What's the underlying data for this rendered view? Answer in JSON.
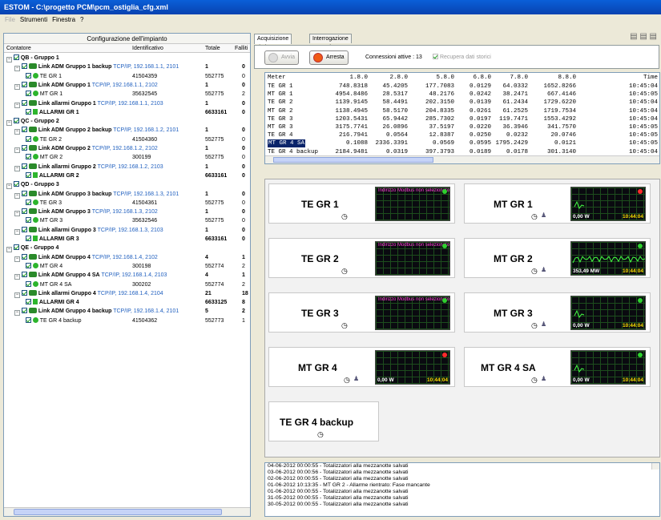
{
  "window": {
    "title": "ESTOM - C:\\progetto PCM\\pcm_ostiglia_cfg.xml"
  },
  "menu": [
    {
      "label": "File",
      "enabled": false
    },
    {
      "label": "Strumenti",
      "enabled": true
    },
    {
      "label": "Finestra",
      "enabled": true
    },
    {
      "label": "?",
      "enabled": true
    }
  ],
  "config": {
    "title": "Configurazione dell'impianto",
    "columns": [
      "Contatore",
      "Identificativo",
      "Totale",
      "Falliti"
    ],
    "rows": [
      {
        "lvl": 0,
        "kind": "group",
        "label": "QB - Gruppo 1",
        "id": "",
        "tot": "",
        "fail": ""
      },
      {
        "lvl": 1,
        "kind": "link",
        "label": "Link ADM Gruppo 1 backup",
        "addr": "TCP/IP, 192.168.1.1, 2101",
        "id": "",
        "tot": "1",
        "fail": "0"
      },
      {
        "lvl": 2,
        "kind": "meter",
        "label": "TE GR 1",
        "id": "41504359",
        "tot": "552775",
        "fail": "0"
      },
      {
        "lvl": 1,
        "kind": "link",
        "label": "Link ADM Gruppo 1",
        "addr": "TCP/IP, 192.168.1.1, 2102",
        "id": "",
        "tot": "1",
        "fail": "0"
      },
      {
        "lvl": 2,
        "kind": "meter",
        "label": "MT GR 1",
        "id": "35632545",
        "tot": "552775",
        "fail": "2"
      },
      {
        "lvl": 1,
        "kind": "link",
        "label": "Link allarmi Gruppo 1",
        "addr": "TCP/IP, 192.168.1.1, 2103",
        "id": "",
        "tot": "1",
        "fail": "0"
      },
      {
        "lvl": 2,
        "kind": "alarm",
        "label": "ALLARMI GR 1",
        "id": "",
        "tot": "6633161",
        "fail": "0"
      },
      {
        "lvl": 0,
        "kind": "group",
        "label": "QC - Gruppo 2",
        "id": "",
        "tot": "",
        "fail": ""
      },
      {
        "lvl": 1,
        "kind": "link",
        "label": "Link ADM Gruppo 2 backup",
        "addr": "TCP/IP, 192.168.1.2, 2101",
        "id": "",
        "tot": "1",
        "fail": "0"
      },
      {
        "lvl": 2,
        "kind": "meter",
        "label": "TE GR 2",
        "id": "41504360",
        "tot": "552775",
        "fail": "0"
      },
      {
        "lvl": 1,
        "kind": "link",
        "label": "Link ADM Gruppo 2",
        "addr": "TCP/IP, 192.168.1.2, 2102",
        "id": "",
        "tot": "1",
        "fail": "0"
      },
      {
        "lvl": 2,
        "kind": "meter",
        "label": "MT GR 2",
        "id": "300199",
        "tot": "552775",
        "fail": "0"
      },
      {
        "lvl": 1,
        "kind": "link",
        "label": "Link allarmi Gruppo 2",
        "addr": "TCP/IP, 192.168.1.2, 2103",
        "id": "",
        "tot": "1",
        "fail": "0"
      },
      {
        "lvl": 2,
        "kind": "alarm",
        "label": "ALLARMI GR 2",
        "id": "",
        "tot": "6633161",
        "fail": "0"
      },
      {
        "lvl": 0,
        "kind": "group",
        "label": "QD - Gruppo 3",
        "id": "",
        "tot": "",
        "fail": ""
      },
      {
        "lvl": 1,
        "kind": "link",
        "label": "Link ADM Gruppo 3 backup",
        "addr": "TCP/IP, 192.168.1.3, 2101",
        "id": "",
        "tot": "1",
        "fail": "0"
      },
      {
        "lvl": 2,
        "kind": "meter",
        "label": "TE GR 3",
        "id": "41504361",
        "tot": "552775",
        "fail": "0"
      },
      {
        "lvl": 1,
        "kind": "link",
        "label": "Link ADM Gruppo 3",
        "addr": "TCP/IP, 192.168.1.3, 2102",
        "id": "",
        "tot": "1",
        "fail": "0"
      },
      {
        "lvl": 2,
        "kind": "meter",
        "label": "MT GR 3",
        "id": "35632546",
        "tot": "552775",
        "fail": "0"
      },
      {
        "lvl": 1,
        "kind": "link",
        "label": "Link allarmi Gruppo 3",
        "addr": "TCP/IP, 192.168.1.3, 2103",
        "id": "",
        "tot": "1",
        "fail": "0"
      },
      {
        "lvl": 2,
        "kind": "alarm",
        "label": "ALLARMI GR 3",
        "id": "",
        "tot": "6633161",
        "fail": "0"
      },
      {
        "lvl": 0,
        "kind": "group",
        "label": "QE - Gruppo 4",
        "id": "",
        "tot": "",
        "fail": ""
      },
      {
        "lvl": 1,
        "kind": "link",
        "label": "Link ADM Gruppo 4",
        "addr": "TCP/IP, 192.168.1.4, 2102",
        "id": "",
        "tot": "4",
        "fail": "1"
      },
      {
        "lvl": 2,
        "kind": "meter",
        "label": "MT GR 4",
        "id": "300198",
        "tot": "552774",
        "fail": "2"
      },
      {
        "lvl": 1,
        "kind": "link",
        "label": "Link ADM Gruppo 4 SA",
        "addr": "TCP/IP, 192.168.1.4, 2103",
        "id": "",
        "tot": "4",
        "fail": "1"
      },
      {
        "lvl": 2,
        "kind": "meter",
        "label": "MT GR 4 SA",
        "id": "300202",
        "tot": "552774",
        "fail": "2"
      },
      {
        "lvl": 1,
        "kind": "link",
        "label": "Link allarmi Gruppo 4",
        "addr": "TCP/IP, 192.168.1.4, 2104",
        "id": "",
        "tot": "21",
        "fail": "18"
      },
      {
        "lvl": 2,
        "kind": "alarm",
        "label": "ALLARMI GR 4",
        "id": "",
        "tot": "6633125",
        "fail": "8"
      },
      {
        "lvl": 1,
        "kind": "link",
        "label": "Link ADM Gruppo 4 backup",
        "addr": "TCP/IP, 192.168.1.4, 2101",
        "id": "",
        "tot": "5",
        "fail": "2"
      },
      {
        "lvl": 2,
        "kind": "meter",
        "label": "TE GR 4 backup",
        "id": "41504362",
        "tot": "552773",
        "fail": "1"
      }
    ]
  },
  "tabs": [
    {
      "label": "Acquisizione dati",
      "active": true
    },
    {
      "label": "Interrogazione manuale",
      "active": false
    }
  ],
  "toolbar": {
    "start": "Avvia",
    "stop": "Arresta",
    "connections": "Connessioni attive : 13",
    "history": "Recupera dati storici"
  },
  "meters": {
    "columns": [
      "Meter",
      "1.8.0",
      "2.8.0",
      "5.8.0",
      "6.8.0",
      "7.8.0",
      "8.8.0",
      "Time"
    ],
    "rows": [
      [
        "TE GR 1",
        "748.8318",
        "45.4205",
        "177.7083",
        "0.0129",
        "64.0332",
        "1652.8266",
        "10:45:04"
      ],
      [
        "MT GR 1",
        "4954.8486",
        "28.5317",
        "48.2176",
        "0.0242",
        "38.2471",
        "667.4146",
        "10:45:05"
      ],
      [
        "TE GR 2",
        "1139.9145",
        "58.4491",
        "202.3150",
        "0.0139",
        "61.2434",
        "1729.6220",
        "10:45:04"
      ],
      [
        "MT GR 2",
        "1138.4945",
        "58.5170",
        "204.8335",
        "0.0261",
        "61.2525",
        "1719.7534",
        "10:45:04"
      ],
      [
        "TE GR 3",
        "1203.5431",
        "65.9442",
        "285.7302",
        "0.0197",
        "119.7471",
        "1553.4292",
        "10:45:04"
      ],
      [
        "MT GR 3",
        "3175.7741",
        "26.0896",
        "37.5197",
        "0.0220",
        "36.3946",
        "341.7570",
        "10:45:05"
      ],
      [
        "TE GR 4",
        "216.7941",
        "0.0564",
        "12.8387",
        "0.0250",
        "0.0232",
        "20.0746",
        "10:45:05"
      ],
      [
        "MT GR 4 SA",
        "0.1088",
        "2336.3391",
        "0.0569",
        "0.0595",
        "1795.2429",
        "0.0121",
        "10:45:05"
      ],
      [
        "TE GR 4 backup",
        "2184.9481",
        "0.0319",
        "397.3793",
        "0.0189",
        "0.0178",
        "301.3140",
        "10:45:04"
      ]
    ],
    "selected": 7
  },
  "panels": [
    {
      "name": "TE GR 1",
      "screen": "msg",
      "msg": "Indirizzo Modbus non selezionato",
      "led": "#2ed12e",
      "value": "",
      "time": "",
      "wave": "none",
      "user": false
    },
    {
      "name": "MT GR 1",
      "screen": "data",
      "msg": "",
      "led": "#ff2b2b",
      "value": "0,00 W",
      "time": "10:44:04",
      "wave": "flat",
      "user": true
    },
    {
      "name": "TE GR 2",
      "screen": "msg",
      "msg": "Indirizzo Modbus non selezionato",
      "led": "#2ed12e",
      "value": "",
      "time": "",
      "wave": "none",
      "user": false
    },
    {
      "name": "MT GR 2",
      "screen": "data",
      "msg": "",
      "led": "#2ed12e",
      "value": "353,49 MW",
      "time": "10:44:04",
      "wave": "noise",
      "user": true
    },
    {
      "name": "TE GR 3",
      "screen": "msg",
      "msg": "Indirizzo Modbus non selezionato",
      "led": "#2ed12e",
      "value": "",
      "time": "",
      "wave": "none",
      "user": false
    },
    {
      "name": "MT GR 3",
      "screen": "data",
      "msg": "",
      "led": "#2ed12e",
      "value": "0,00 W",
      "time": "10:44:04",
      "wave": "flat",
      "user": true
    },
    {
      "name": "MT GR 4",
      "screen": "data",
      "msg": "",
      "led": "#ff2b2b",
      "value": "0,00 W",
      "time": "10:44:04",
      "wave": "none",
      "user": true
    },
    {
      "name": "MT GR 4 SA",
      "screen": "data",
      "msg": "",
      "led": "#2ed12e",
      "value": "0,00 W",
      "time": "10:44:04",
      "wave": "flat",
      "user": true
    },
    {
      "name": "TE GR 4 backup",
      "screen": "none",
      "msg": "",
      "led": "",
      "value": "",
      "time": "",
      "wave": "none",
      "user": false
    }
  ],
  "log": [
    "04-06-2012 00:00:55 - Totalizzatori alla mezzanotte salvati",
    "03-06-2012 00:00:56 - Totalizzatori alla mezzanotte salvati",
    "02-06-2012 00:00:55 - Totalizzatori alla mezzanotte salvati",
    "01-06-2012 10:13:35 - MT GR 2 - Allarme rientrato: Fase mancante",
    "01-06-2012 00:00:55 - Totalizzatori alla mezzanotte salvati",
    "31-05-2012 00:00:55 - Totalizzatori alla mezzanotte salvati",
    "30-05-2012 00:00:55 - Totalizzatori alla mezzanotte salvati"
  ]
}
